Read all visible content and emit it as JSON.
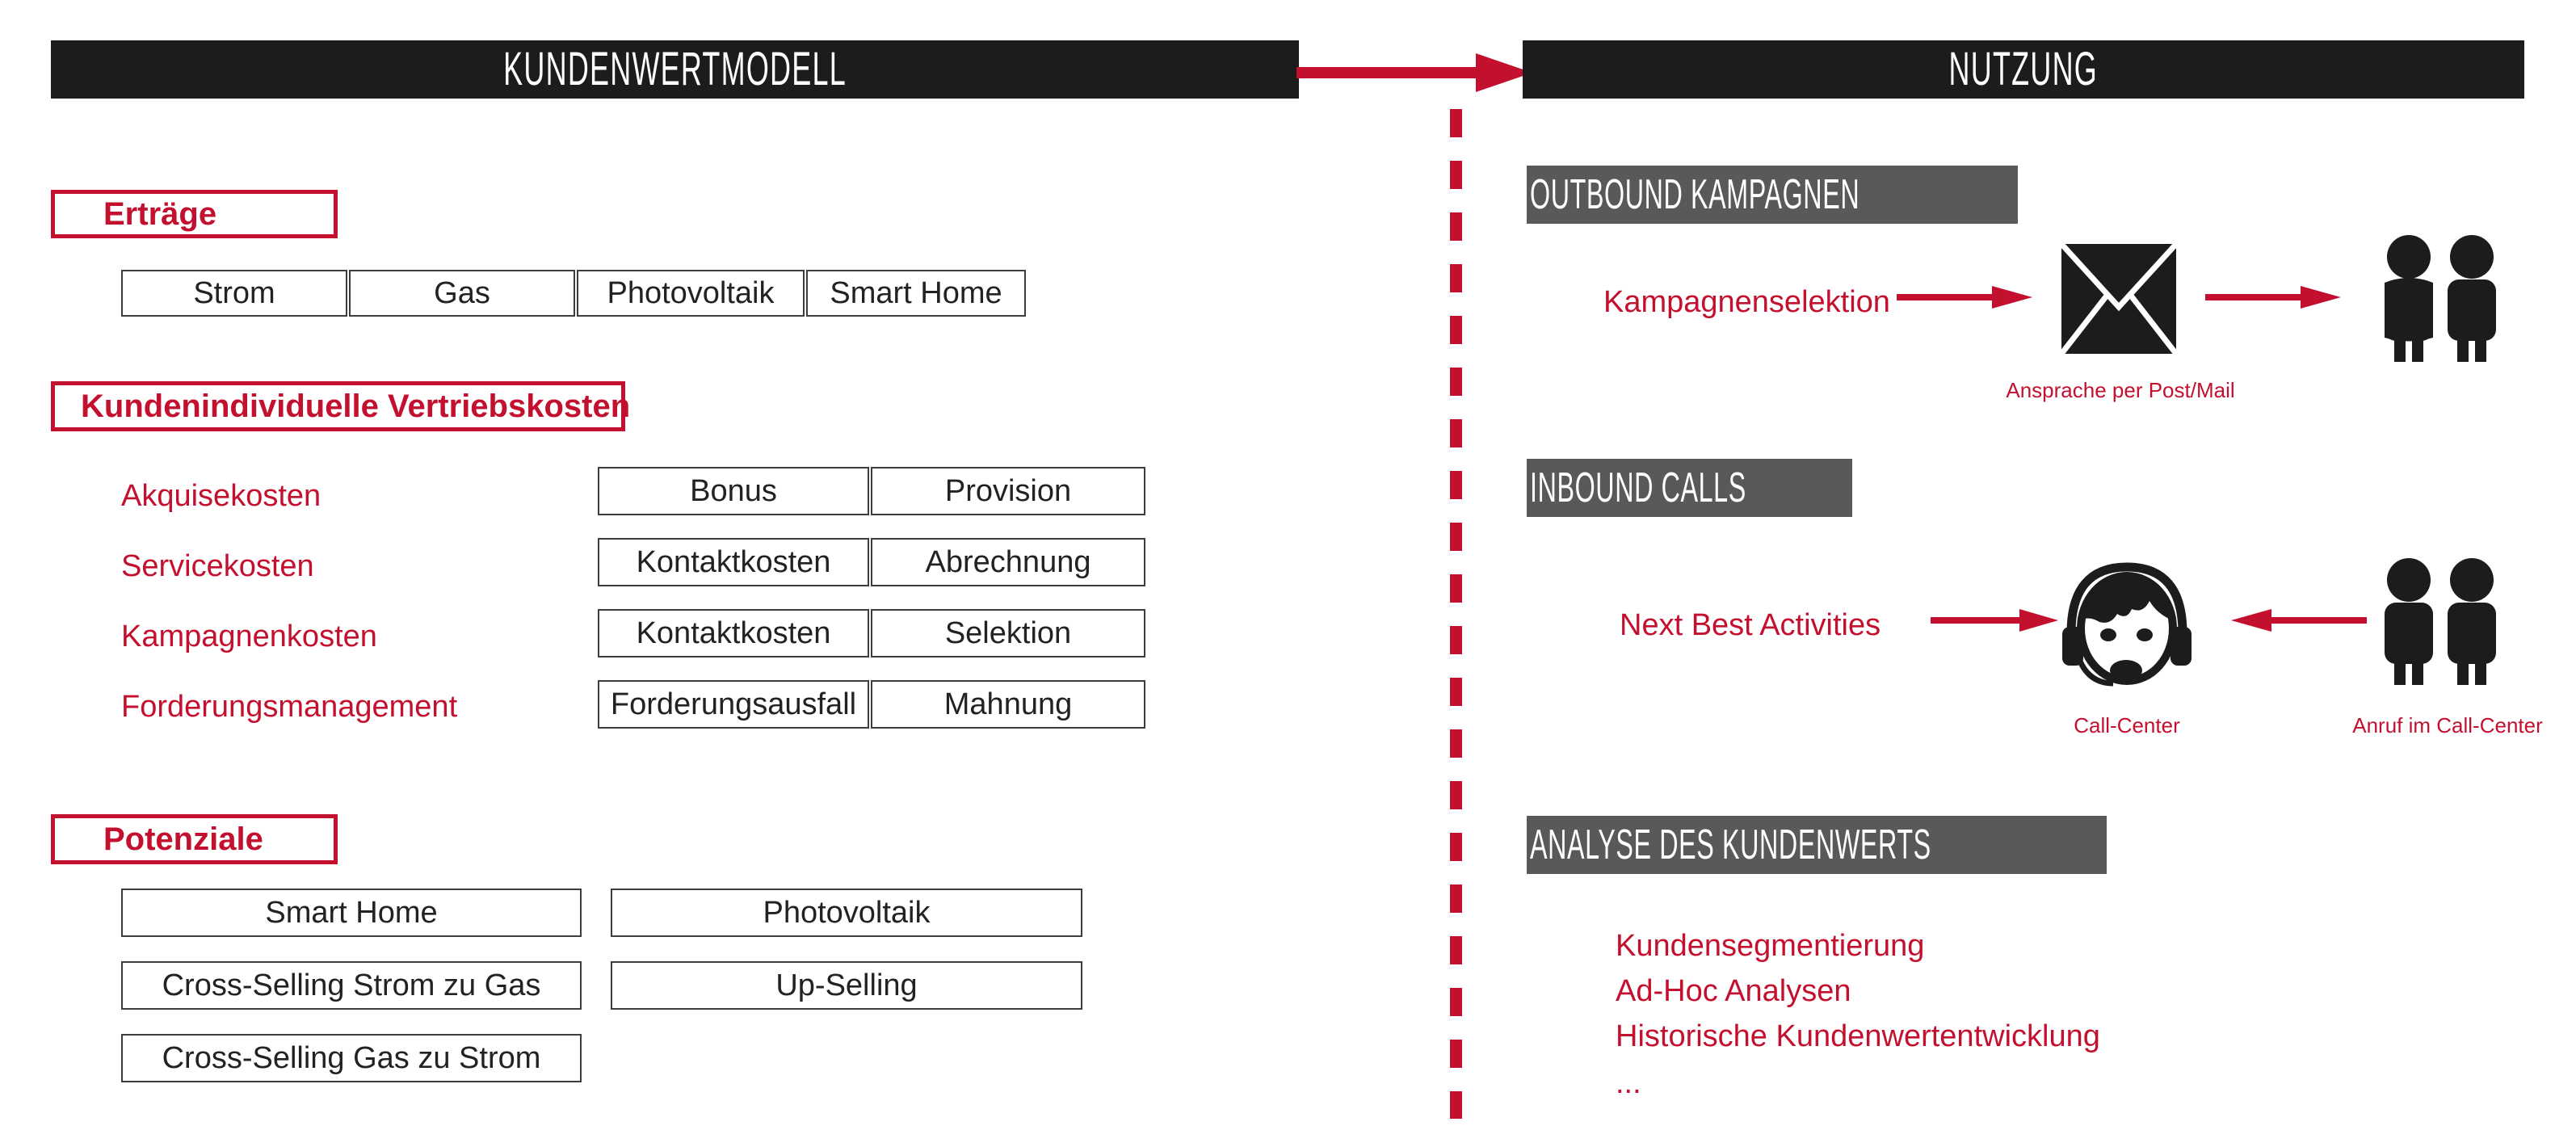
{
  "colors": {
    "brand_red": "#C4102F",
    "header_black": "#1C1C1C",
    "band_gray": "#595959",
    "box_border": "#3D3D3D"
  },
  "left_panel": {
    "header": "KUNDENWERTMODELL",
    "groups": [
      {
        "label": "Erträge",
        "boxes": [
          "Strom",
          "Gas",
          "Photovoltaik",
          "Smart Home"
        ]
      },
      {
        "label": "Kundenindividuelle Vertriebskosten",
        "rows": [
          {
            "label": "Akquisekosten",
            "cells": [
              "Bonus",
              "Provision"
            ]
          },
          {
            "label": "Servicekosten",
            "cells": [
              "Kontaktkosten",
              "Abrechnung"
            ]
          },
          {
            "label": "Kampagnenkosten",
            "cells": [
              "Kontaktkosten",
              "Selektion"
            ]
          },
          {
            "label": "Forderungsmanagement",
            "cells": [
              "Forderungsausfall",
              "Mahnung"
            ]
          }
        ]
      },
      {
        "label": "Potenziale",
        "col_left": [
          "Smart Home",
          "Cross-Selling Strom zu Gas",
          "Cross-Selling Gas zu Strom"
        ],
        "col_right": [
          "Photovoltaik",
          "Up-Selling"
        ]
      }
    ]
  },
  "right_panel": {
    "header": "NUTZUNG",
    "sections": [
      {
        "band": "OUTBOUND KAMPAGNEN",
        "source_label": "Kampagnenselektion",
        "icon_caption": "Ansprache per Post/Mail",
        "icons": [
          "envelope-icon",
          "two-people-icon"
        ]
      },
      {
        "band": "INBOUND CALLS",
        "source_label": "Next Best Activities",
        "agent_caption": "Call-Center",
        "customer_caption": "Anruf im Call-Center",
        "icons": [
          "call-center-agent-icon",
          "two-people-icon"
        ]
      },
      {
        "band": "ANALYSE DES KUNDENWERTS",
        "items": [
          "Kundensegmentierung",
          "Ad-Hoc Analysen",
          "Historische Kundenwertentwicklung",
          "..."
        ]
      }
    ]
  }
}
